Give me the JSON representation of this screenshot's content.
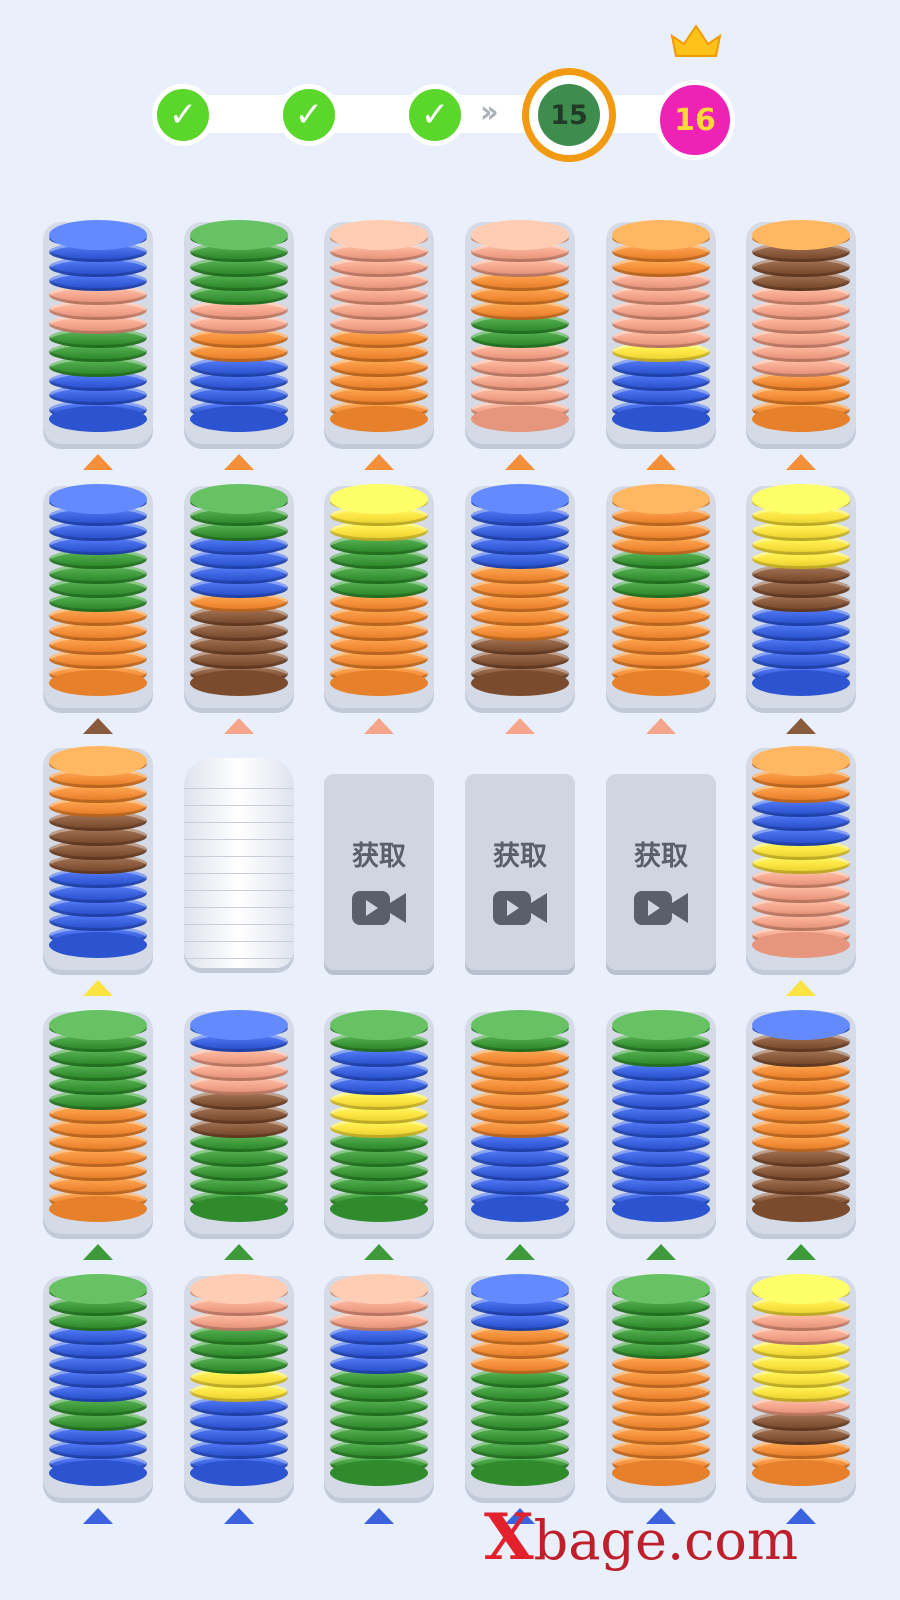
{
  "progress": {
    "completed": [
      "check",
      "check",
      "check"
    ],
    "current_level": "15",
    "next_level": "16",
    "next_reward_icon": "crown-icon"
  },
  "colors": {
    "blue": "#3b63e0",
    "green": "#3f9a3c",
    "salmon": "#f5a58c",
    "orange": "#f58f3a",
    "brown": "#8a5a3d",
    "yellow": "#fbe342",
    "accent_orange": "#f29a12",
    "accent_pink": "#ee22b5"
  },
  "board": {
    "rows": [
      {
        "marker": "orange",
        "tubes": [
          {
            "stack": [
              "blue",
              "blue",
              "blue",
              "blue",
              "salmon",
              "salmon",
              "salmon",
              "green",
              "green",
              "green",
              "blue",
              "blue",
              "blue"
            ]
          },
          {
            "stack": [
              "green",
              "green",
              "green",
              "green",
              "green",
              "salmon",
              "salmon",
              "orange",
              "orange",
              "blue",
              "blue",
              "blue",
              "blue"
            ]
          },
          {
            "stack": [
              "salmon",
              "salmon",
              "salmon",
              "salmon",
              "salmon",
              "salmon",
              "salmon",
              "orange",
              "orange",
              "orange",
              "orange",
              "orange",
              "orange"
            ]
          },
          {
            "stack": [
              "salmon",
              "salmon",
              "salmon",
              "orange",
              "orange",
              "orange",
              "green",
              "green",
              "salmon",
              "salmon",
              "salmon",
              "salmon",
              "salmon"
            ]
          },
          {
            "stack": [
              "orange",
              "orange",
              "orange",
              "salmon",
              "salmon",
              "salmon",
              "salmon",
              "salmon",
              "yellow",
              "blue",
              "blue",
              "blue",
              "blue"
            ]
          },
          {
            "stack": [
              "orange",
              "brown",
              "brown",
              "brown",
              "salmon",
              "salmon",
              "salmon",
              "salmon",
              "salmon",
              "salmon",
              "orange",
              "orange",
              "orange"
            ]
          }
        ]
      },
      {
        "tubes": [
          {
            "stack": [
              "blue",
              "blue",
              "blue",
              "blue",
              "green",
              "green",
              "green",
              "green",
              "orange",
              "orange",
              "orange",
              "orange",
              "orange"
            ],
            "marker": "brown"
          },
          {
            "stack": [
              "green",
              "green",
              "green",
              "blue",
              "blue",
              "blue",
              "blue",
              "orange",
              "brown",
              "brown",
              "brown",
              "brown",
              "brown"
            ],
            "marker": "salmon"
          },
          {
            "stack": [
              "yellow",
              "yellow",
              "yellow",
              "green",
              "green",
              "green",
              "green",
              "orange",
              "orange",
              "orange",
              "orange",
              "orange",
              "orange"
            ],
            "marker": "salmon"
          },
          {
            "stack": [
              "blue",
              "blue",
              "blue",
              "blue",
              "blue",
              "orange",
              "orange",
              "orange",
              "orange",
              "orange",
              "brown",
              "brown",
              "brown"
            ],
            "marker": "salmon"
          },
          {
            "stack": [
              "orange",
              "orange",
              "orange",
              "orange",
              "green",
              "green",
              "green",
              "orange",
              "orange",
              "orange",
              "orange",
              "orange",
              "orange"
            ],
            "marker": "salmon"
          },
          {
            "stack": [
              "yellow",
              "yellow",
              "yellow",
              "yellow",
              "yellow",
              "brown",
              "brown",
              "brown",
              "blue",
              "blue",
              "blue",
              "blue",
              "blue"
            ],
            "marker": "brown"
          }
        ]
      },
      {
        "tubes": [
          {
            "type": "full",
            "stack": [
              "orange",
              "orange",
              "orange",
              "orange",
              "brown",
              "brown",
              "brown",
              "brown",
              "blue",
              "blue",
              "blue",
              "blue",
              "blue"
            ],
            "marker": "yellow"
          },
          {
            "type": "empty"
          },
          {
            "type": "locked",
            "label": "获取"
          },
          {
            "type": "locked",
            "label": "获取"
          },
          {
            "type": "locked",
            "label": "获取"
          },
          {
            "type": "full",
            "stack": [
              "orange",
              "orange",
              "orange",
              "blue",
              "blue",
              "blue",
              "yellow",
              "yellow",
              "salmon",
              "salmon",
              "salmon",
              "salmon",
              "salmon"
            ],
            "marker": "yellow"
          }
        ]
      },
      {
        "marker": "green",
        "tubes": [
          {
            "stack": [
              "green",
              "green",
              "green",
              "green",
              "green",
              "green",
              "orange",
              "orange",
              "orange",
              "orange",
              "orange",
              "orange",
              "orange"
            ]
          },
          {
            "stack": [
              "blue",
              "blue",
              "salmon",
              "salmon",
              "salmon",
              "brown",
              "brown",
              "brown",
              "green",
              "green",
              "green",
              "green",
              "green"
            ]
          },
          {
            "stack": [
              "green",
              "green",
              "blue",
              "blue",
              "blue",
              "yellow",
              "yellow",
              "yellow",
              "green",
              "green",
              "green",
              "green",
              "green"
            ]
          },
          {
            "stack": [
              "green",
              "green",
              "orange",
              "orange",
              "orange",
              "orange",
              "orange",
              "orange",
              "blue",
              "blue",
              "blue",
              "blue",
              "blue"
            ]
          },
          {
            "stack": [
              "green",
              "green",
              "green",
              "blue",
              "blue",
              "blue",
              "blue",
              "blue",
              "blue",
              "blue",
              "blue",
              "blue",
              "blue"
            ]
          },
          {
            "stack": [
              "blue",
              "brown",
              "brown",
              "orange",
              "orange",
              "orange",
              "orange",
              "orange",
              "orange",
              "brown",
              "brown",
              "brown",
              "brown"
            ]
          }
        ]
      },
      {
        "marker": "blue",
        "tubes": [
          {
            "stack": [
              "green",
              "green",
              "green",
              "blue",
              "blue",
              "blue",
              "blue",
              "blue",
              "green",
              "green",
              "blue",
              "blue",
              "blue"
            ]
          },
          {
            "stack": [
              "salmon",
              "salmon",
              "salmon",
              "green",
              "green",
              "green",
              "yellow",
              "yellow",
              "blue",
              "blue",
              "blue",
              "blue",
              "blue"
            ]
          },
          {
            "stack": [
              "salmon",
              "salmon",
              "salmon",
              "blue",
              "blue",
              "blue",
              "green",
              "green",
              "green",
              "green",
              "green",
              "green",
              "green"
            ]
          },
          {
            "stack": [
              "blue",
              "blue",
              "blue",
              "orange",
              "orange",
              "orange",
              "green",
              "green",
              "green",
              "green",
              "green",
              "green",
              "green"
            ]
          },
          {
            "stack": [
              "green",
              "green",
              "green",
              "green",
              "green",
              "orange",
              "orange",
              "orange",
              "orange",
              "orange",
              "orange",
              "orange",
              "orange"
            ]
          },
          {
            "stack": [
              "yellow",
              "yellow",
              "salmon",
              "salmon",
              "yellow",
              "yellow",
              "yellow",
              "yellow",
              "salmon",
              "brown",
              "brown",
              "orange",
              "orange"
            ]
          }
        ]
      }
    ]
  },
  "watermark": {
    "mark": "X",
    "text": "bage.com"
  }
}
